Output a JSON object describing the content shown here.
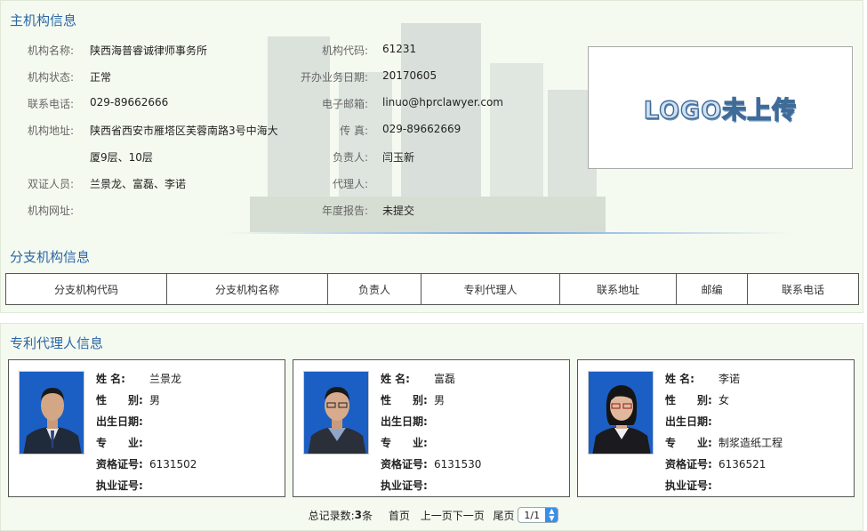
{
  "main": {
    "title": "主机构信息",
    "fields": {
      "name": {
        "label": "机构名称:",
        "value": "陕西海普睿诚律师事务所"
      },
      "code": {
        "label": "机构代码:",
        "value": "61231"
      },
      "status": {
        "label": "机构状态:",
        "value": "正常"
      },
      "open_date": {
        "label": "开办业务日期:",
        "value": "20170605"
      },
      "phone": {
        "label": "联系电话:",
        "value": "029-89662666"
      },
      "email": {
        "label": "电子邮箱:",
        "value": "linuo@hprclawyer.com"
      },
      "address": {
        "label": "机构地址:",
        "value_line1": "陕西省西安市雁塔区芙蓉南路3号中海大",
        "value_line2": "厦9层、10层"
      },
      "fax": {
        "label": "传 真:",
        "value": "029-89662669"
      },
      "leader": {
        "label": "负责人:",
        "value": "闫玉新"
      },
      "dual_cert": {
        "label": "双证人员:",
        "value": "兰景龙、富磊、李诺"
      },
      "agent": {
        "label": "代理人:",
        "value": ""
      },
      "website": {
        "label": "机构网址:",
        "value": ""
      },
      "annual_report": {
        "label": "年度报告:",
        "value": "未提交"
      }
    },
    "logo_text": "LOGO未上传"
  },
  "branch": {
    "title": "分支机构信息",
    "columns": [
      "分支机构代码",
      "分支机构名称",
      "负责人",
      "专利代理人",
      "联系地址",
      "邮编",
      "联系电话"
    ]
  },
  "agents": {
    "title": "专利代理人信息",
    "labels": {
      "name": "姓 名:",
      "gender": "性　　别:",
      "birth": "出生日期:",
      "major": "专　　业:",
      "qual": "资格证号:",
      "practice": "执业证号:"
    },
    "items": [
      {
        "name": "兰景龙",
        "gender": "男",
        "birth": "",
        "major": "",
        "qual": "6131502",
        "practice": ""
      },
      {
        "name": "富磊",
        "gender": "男",
        "birth": "",
        "major": "",
        "qual": "6131530",
        "practice": ""
      },
      {
        "name": "李诺",
        "gender": "女",
        "birth": "",
        "major": "制浆造纸工程",
        "qual": "6136521",
        "practice": ""
      }
    ]
  },
  "pager": {
    "total_label": "总记录数:",
    "total": "3",
    "total_unit": "条",
    "first": "首页",
    "prev": "上一页",
    "next": "下一页",
    "last": "尾页",
    "page_value": "1/1"
  },
  "colors": {
    "title_blue": "#2a66a8",
    "panel_bg": "#f5faf0",
    "photo_bg": "#1b5fc4"
  }
}
